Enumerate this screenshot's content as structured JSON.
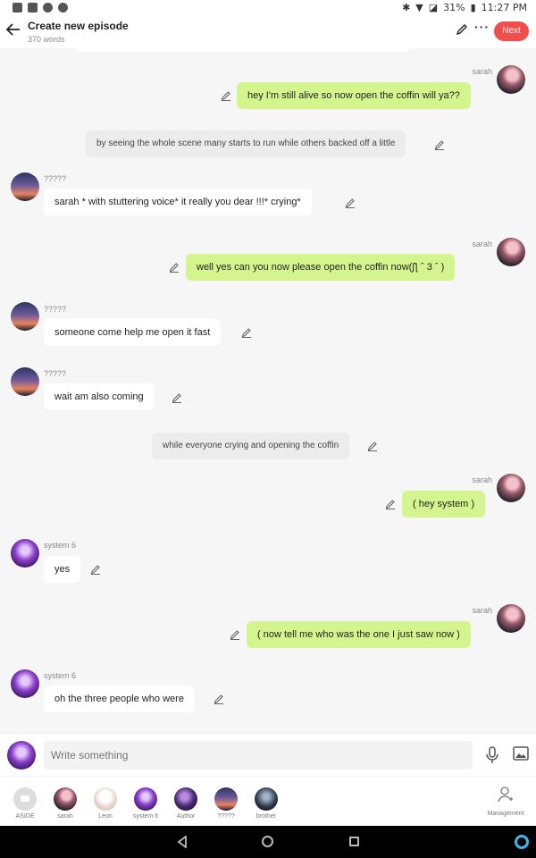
{
  "status_bar": {
    "battery": "31%",
    "time": "11:27 PM"
  },
  "header": {
    "title": "Create new episode",
    "word_count": "370 words",
    "next_label": "Next"
  },
  "messages": [
    {
      "type": "right",
      "name": "sarah",
      "text": "hey I'm still alive so now open the coffin will ya??"
    },
    {
      "type": "aside",
      "text": "by seeing the whole scene many starts to run while others backed off a little"
    },
    {
      "type": "left",
      "name": "?????",
      "text": "sarah * with stuttering voice* it really you dear !!!* crying*"
    },
    {
      "type": "right",
      "name": "sarah",
      "text": "well yes can you now please open the coffin now(ʃƪ ˆ 3 ˆ )"
    },
    {
      "type": "left",
      "name": "?????",
      "text": "someone come help me open it fast"
    },
    {
      "type": "left",
      "name": "?????",
      "text": "wait am also coming"
    },
    {
      "type": "aside",
      "text": "while everyone crying and opening the coffin"
    },
    {
      "type": "right",
      "name": "sarah",
      "text": "( hey system )"
    },
    {
      "type": "left",
      "name": "system 6",
      "text": "yes"
    },
    {
      "type": "right",
      "name": "sarah",
      "text": "( now tell me who was the one I just saw now )"
    },
    {
      "type": "left",
      "name": "system 6",
      "text": "oh the three people who were"
    }
  ],
  "input": {
    "placeholder": "Write something"
  },
  "characters": [
    {
      "label": "ASIDE",
      "icon": "aside-icon"
    },
    {
      "label": "sarah",
      "icon": "sarah-avatar"
    },
    {
      "label": "Leon",
      "icon": "leon-avatar"
    },
    {
      "label": "system 6",
      "icon": "system-6-avatar"
    },
    {
      "label": "Author",
      "icon": "author-avatar"
    },
    {
      "label": "?????",
      "icon": "unknown-avatar"
    },
    {
      "label": "brother",
      "icon": "brother-avatar"
    }
  ],
  "management_label": "Management",
  "colors": {
    "accent": "#f04d4d",
    "own_bubble": "#d4f58e",
    "other_bubble": "#ffffff",
    "aside_bubble": "#ececec"
  }
}
